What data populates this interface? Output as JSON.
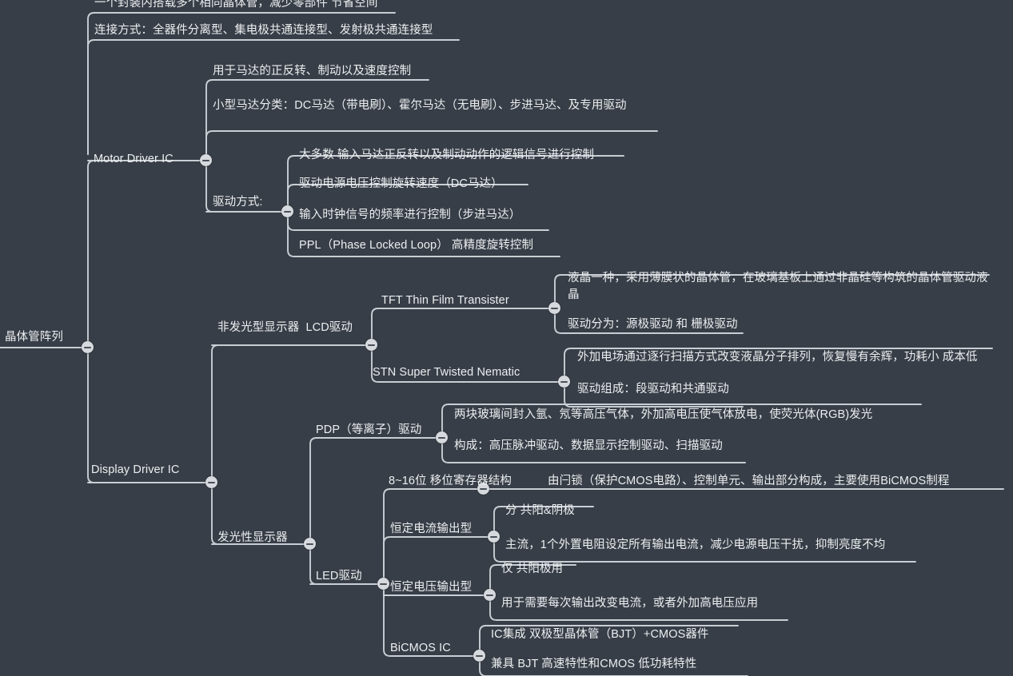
{
  "meta": {
    "app": "mindmap-viewer",
    "background_color": "#383e47",
    "line_color": "#c9ced4",
    "text_color": "#eceff1",
    "toggle_color": "#d6d9dd"
  },
  "root": {
    "label": "晶体管阵列"
  },
  "nodes": {
    "n_array_note1": "一个封装内搭载多个相同晶体管，减少零部件 节省空间",
    "n_array_note2": "连接方式：全器件分离型、集电极共通连接型、发射极共通连接型",
    "n_motor": "Motor Driver IC",
    "n_motor_1": "用于马达的正反转、制动以及速度控制",
    "n_motor_2": "小型马达分类：DC马达（带电刷）、霍尔马达（无电刷）、步进马达、及专用驱动",
    "n_drive_mode": "驱动方式:",
    "n_drive_1": "大多数 输入马达正反转以及制动动作的逻辑信号进行控制",
    "n_drive_2": "驱动电源电压控制旋转速度（DC马达）",
    "n_drive_3": "输入时钟信号的频率进行控制（步进马达）",
    "n_drive_4": "PPL（Phase Locked Loop） 高精度旋转控制",
    "n_display": "Display Driver IC",
    "n_lcd": "非发光型显示器  LCD驱动",
    "n_tft": "TFT Thin Film Transister",
    "n_tft_1": "液晶一种，采用薄膜状的晶体管，在玻璃基板上通过非晶硅等构筑的晶体管驱动液晶",
    "n_tft_2": "驱动分为：源极驱动 和 栅极驱动",
    "n_stn": "STN Super Twisted Nematic",
    "n_stn_1": "外加电场通过逐行扫描方式改变液晶分子排列，恢复慢有余辉，功耗小 成本低",
    "n_stn_2": "驱动组成：段驱动和共通驱动",
    "n_emissive": "发光性显示器",
    "n_pdp": "PDP（等离子）驱动",
    "n_pdp_1": "两块玻璃间封入氩、氖等高压气体，外加高电压使气体放电，使荧光体(RGB)发光",
    "n_pdp_2": "构成：高压脉冲驱动、数据显示控制驱动、扫描驱动",
    "n_led": "LED驱动",
    "n_shift": "8~16位 移位寄存器结构",
    "n_shift_1": "由闩锁（保护CMOS电路）、控制单元、输出部分构成，主要使用BiCMOS制程",
    "n_cc": "恒定电流输出型",
    "n_cc_1": "分 共阳&阴极",
    "n_cc_2": "主流，1个外置电阻设定所有输出电流，减少电源电压干扰，抑制亮度不均",
    "n_cv": "恒定电压输出型",
    "n_cv_1": "仅 共阳极用",
    "n_cv_2": "用于需要每次输出改变电流，或者外加高电压应用",
    "n_bicmos": "BiCMOS IC",
    "n_bicmos_1": "IC集成 双极型晶体管（BJT）+CMOS器件",
    "n_bicmos_2": "兼具 BJT 高速特性和CMOS 低功耗特性"
  }
}
